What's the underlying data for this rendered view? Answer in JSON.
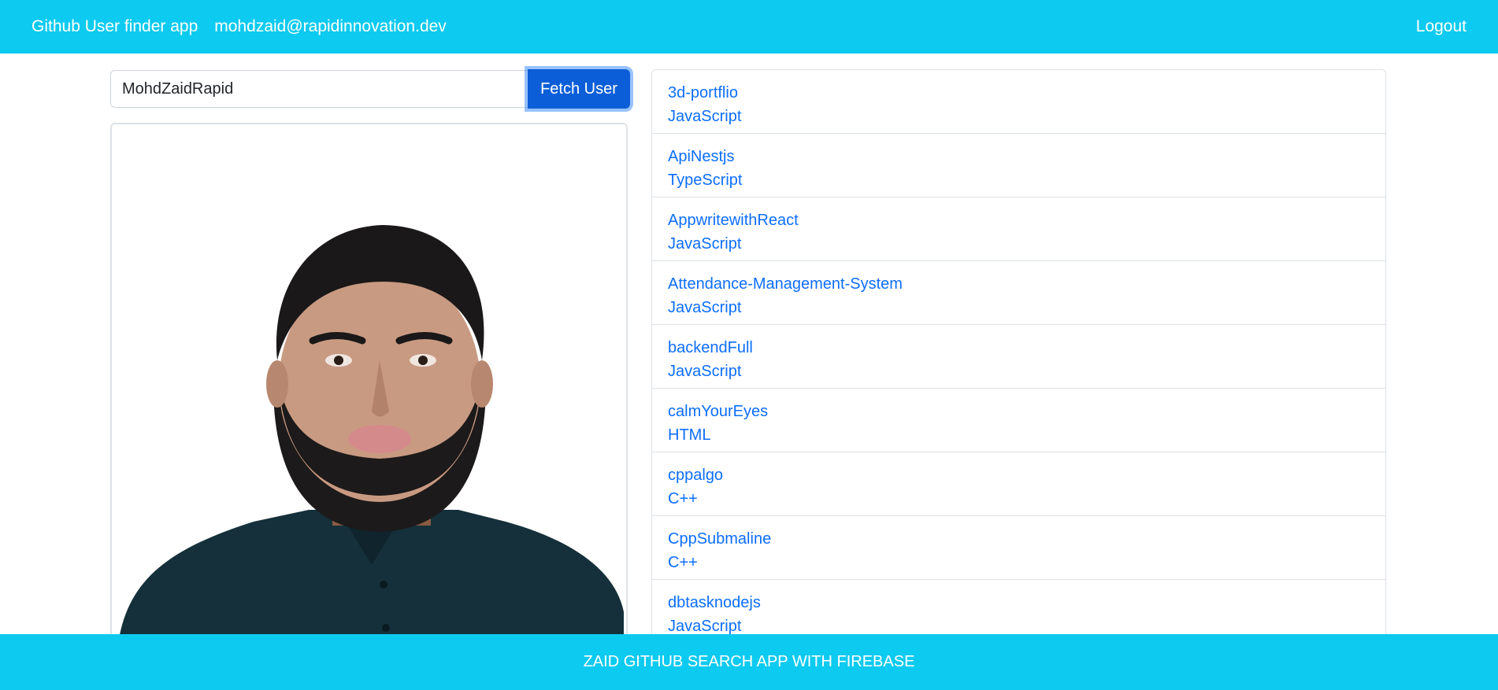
{
  "navbar": {
    "brand": "Github User finder app",
    "user_email": "mohdzaid@rapidinnovation.dev",
    "logout_label": "Logout"
  },
  "search": {
    "value": "MohdZaidRapid",
    "button_label": "Fetch User"
  },
  "profile": {
    "avatar_icon": "user-avatar-photo"
  },
  "repos": [
    {
      "name": "3d-portflio",
      "language": "JavaScript"
    },
    {
      "name": "ApiNestjs",
      "language": "TypeScript"
    },
    {
      "name": "AppwritewithReact",
      "language": "JavaScript"
    },
    {
      "name": "Attendance-Management-System",
      "language": "JavaScript"
    },
    {
      "name": "backendFull",
      "language": "JavaScript"
    },
    {
      "name": "calmYourEyes",
      "language": "HTML"
    },
    {
      "name": "cppalgo",
      "language": "C++"
    },
    {
      "name": "CppSubmaline",
      "language": "C++"
    },
    {
      "name": "dbtasknodejs",
      "language": "JavaScript"
    }
  ],
  "footer": {
    "text": "ZAID GITHUB SEARCH APP WITH FIREBASE"
  },
  "colors": {
    "navbar": "#0dcaf0",
    "button": "#0b5ed7",
    "link": "#0d6efd"
  }
}
